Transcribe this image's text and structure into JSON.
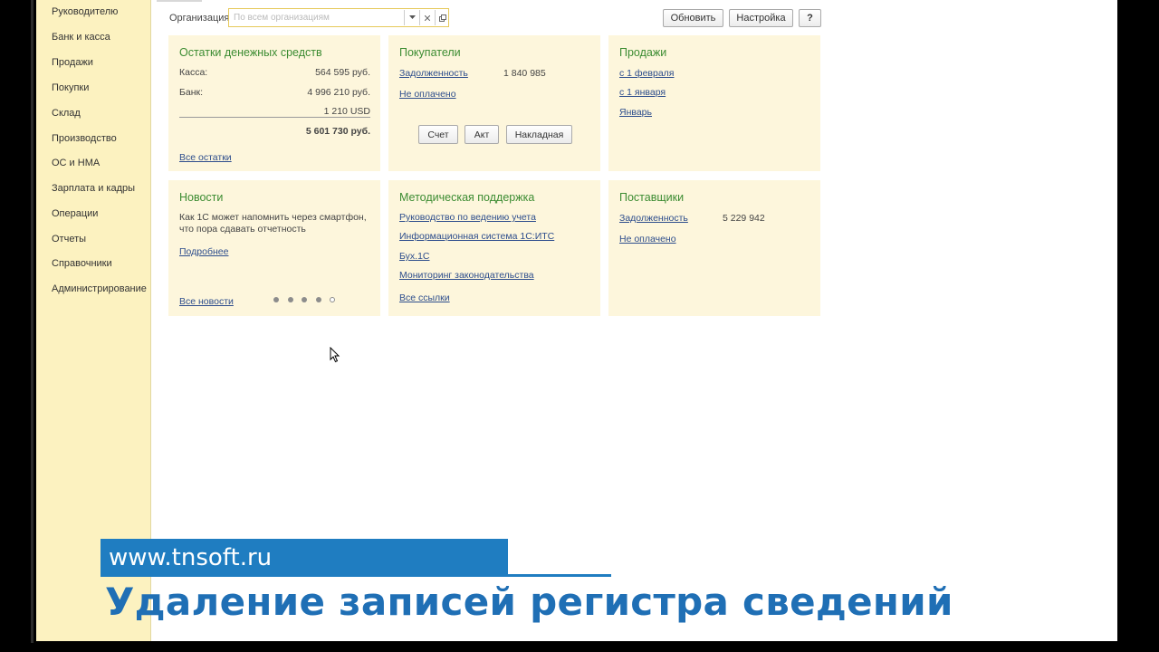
{
  "sidebar": {
    "items": [
      {
        "label": "Руководителю"
      },
      {
        "label": "Банк и касса"
      },
      {
        "label": "Продажи"
      },
      {
        "label": "Покупки"
      },
      {
        "label": "Склад"
      },
      {
        "label": "Производство"
      },
      {
        "label": "ОС и НМА"
      },
      {
        "label": "Зарплата и кадры"
      },
      {
        "label": "Операции"
      },
      {
        "label": "Отчеты"
      },
      {
        "label": "Справочники"
      },
      {
        "label": "Администрирование"
      }
    ]
  },
  "toolbar": {
    "org_label": "Организация:",
    "org_placeholder": "По всем организациям",
    "dropdown_icon": "chevron-down-icon",
    "clear_icon": "close-icon",
    "open_icon": "open-window-icon",
    "refresh_label": "Обновить",
    "settings_label": "Настройка",
    "help_label": "?"
  },
  "panels": {
    "cash": {
      "title": "Остатки денежных средств",
      "kassa_label": "Касса:",
      "kassa_value": "564 595 руб.",
      "bank_label": "Банк:",
      "bank_value": "4 996 210 руб.",
      "usd_value": "1 210 USD",
      "total_value": "5 601 730 руб.",
      "all_link": "Все остатки"
    },
    "customers": {
      "title": "Покупатели",
      "debt_link": "Задолженность",
      "debt_value": "1 840 985",
      "unpaid_link": "Не оплачено",
      "invoice_btn": "Счет",
      "act_btn": "Акт",
      "waybill_btn": "Накладная"
    },
    "sales": {
      "title": "Продажи",
      "link1": "с 1 февраля",
      "link2": "с 1 января",
      "link3": "Январь"
    },
    "news": {
      "title": "Новости",
      "text_line1": "Как 1С может напомнить через смартфон,",
      "text_line2": "что пора сдавать отчетность",
      "more_link": "Подробнее",
      "all_link": "Все новости",
      "page_count": 5,
      "active_page": 5
    },
    "support": {
      "title": "Методическая поддержка",
      "link1": "Руководство по ведению учета",
      "link2": "Информационная система 1С:ИТС",
      "link3": "Бух.1С",
      "link4": "Мониторинг законодательства",
      "all_link": "Все ссылки"
    },
    "suppliers": {
      "title": "Поставщики",
      "debt_link": "Задолженность",
      "debt_value": "5 229 942",
      "unpaid_link": "Не оплачено"
    }
  },
  "overlay": {
    "site": "www.tnsoft.ru",
    "title": "Удаление записей регистра сведений"
  },
  "colors": {
    "sidebar_bg": "#fcf2c0",
    "panel_bg": "#fdf6dc",
    "title_green": "#3c8c32",
    "link_blue": "#2d4d8c",
    "banner_blue": "#1f7dc1"
  }
}
